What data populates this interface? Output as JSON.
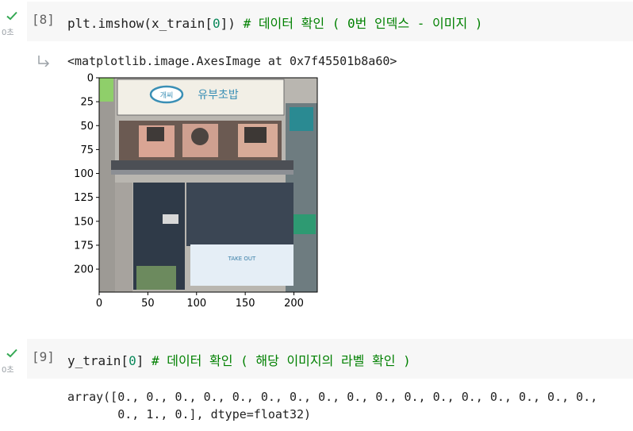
{
  "cells": [
    {
      "prompt": "[8]",
      "exec_time": "0초",
      "code": {
        "call": "plt.imshow(x_train[",
        "num": "0",
        "call_end": "])",
        "comment": " # 데이터 확인 ( 0번 인덱스 - 이미지 )"
      },
      "output_text": "<matplotlib.image.AxesImage at 0x7f45501b8a60>",
      "image": {
        "x_ticks": [
          "0",
          "50",
          "100",
          "150",
          "200"
        ],
        "y_ticks": [
          "0",
          "25",
          "50",
          "75",
          "100",
          "125",
          "150",
          "175",
          "200"
        ],
        "sign_text": "유부초밥",
        "sign_small": "개씨",
        "window_text": "TAKE OUT"
      }
    },
    {
      "prompt": "[9]",
      "exec_time": "0초",
      "code": {
        "call": "y_train[",
        "num": "0",
        "call_end": "]",
        "comment": " # 데이터 확인 ( 해당 이미지의 라벨 확인 )"
      },
      "output_lines": [
        "array([0., 0., 0., 0., 0., 0., 0., 0., 0., 0., 0., 0., 0., 0., 0., 0., 0.,",
        "       0., 1., 0.], dtype=float32)"
      ]
    }
  ],
  "colors": {
    "check": "#34a853",
    "comment": "#008000",
    "number": "#09885a",
    "cell_bg": "#f7f7f7"
  }
}
